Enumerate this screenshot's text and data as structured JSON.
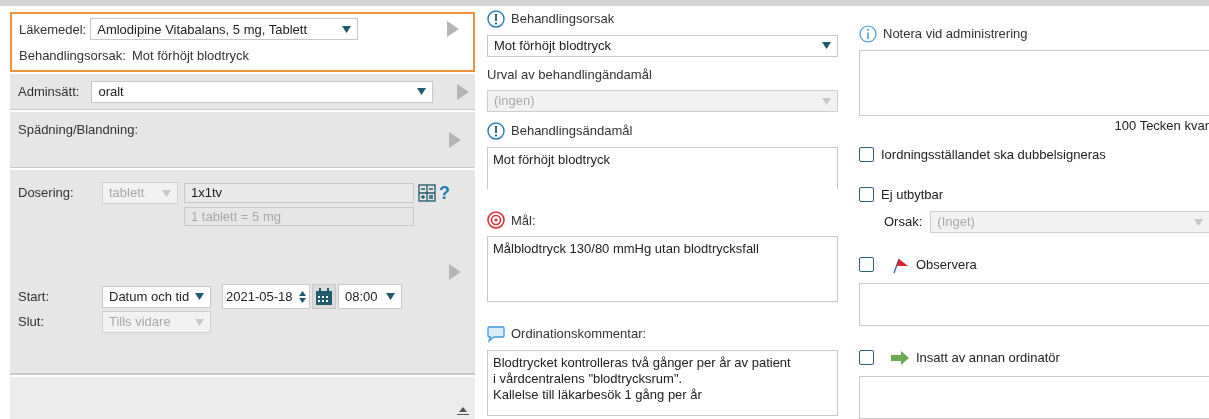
{
  "medication": {
    "label": "Läkemedel:",
    "value": "Amlodipine Vitabalans, 5 mg, Tablett",
    "reason_label": "Behandlingsorsak:",
    "reason": "Mot förhöjt blodtryck"
  },
  "admin_route": {
    "label": "Adminsätt:",
    "value": "oralt"
  },
  "dilution": {
    "label": "Spädning/Blandning:"
  },
  "dosing": {
    "label": "Dosering:",
    "unit": {
      "value": "tablett",
      "disabled": true
    },
    "dose": "1x1tv",
    "conversion": "1 tablett = 5 mg",
    "help": "?"
  },
  "start": {
    "label": "Start:",
    "type": "Datum och tid",
    "date": "2021-05-18",
    "time": "08:00"
  },
  "end": {
    "label": "Slut:",
    "value": "Tills vidare",
    "disabled": true
  },
  "treatment_reason": {
    "label": "Behandlingsorsak",
    "value": "Mot förhöjt blodtryck"
  },
  "purpose_selection": {
    "label": "Urval av behandlingändamål",
    "value": "(ingen)",
    "disabled": true
  },
  "purpose": {
    "label": "Behandlingsändamål",
    "value": "Mot förhöjt blodtryck"
  },
  "goal": {
    "label": "Mål:",
    "value": "Målblodtryck 130/80 mmHg utan blodtrycksfall"
  },
  "comment": {
    "label": "Ordinationskommentar:",
    "value": "Blodtrycket kontrolleras två gånger per år av patient i vårdcentralens \"blodtrycksrum\".\nKallelse till läkarbesök 1 gång per år"
  },
  "admin_note": {
    "label": "Notera vid administrering",
    "counter": "100 Tecken kvar"
  },
  "options": [
    {
      "kind": "plain",
      "label": "Iordningsställandet ska dubbelsigneras",
      "checked": false
    },
    {
      "kind": "reason",
      "label": "Ej utbytbar",
      "checked": false,
      "reason_label": "Orsak:",
      "reason": "(Inget)",
      "reason_disabled": true
    },
    {
      "kind": "flag",
      "label": "Observera",
      "checked": false
    },
    {
      "kind": "arrow",
      "label": "Insatt av annan ordinatör",
      "checked": false
    }
  ]
}
